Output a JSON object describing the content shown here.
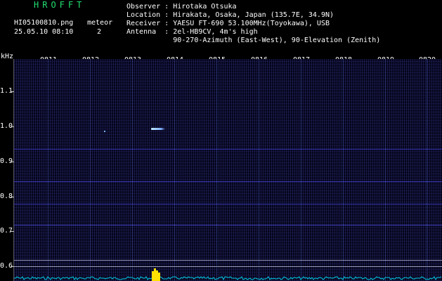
{
  "header": {
    "app_title": "HROFFT",
    "file_name": "HI05100810.png",
    "meteor_label": "meteor",
    "timestamp": "25.05.10 08:10",
    "meteor_count": "2",
    "observer": "Observer : Hirotaka Otsuka",
    "location": "Location : Hirakata, Osaka, Japan (135.7E, 34.9N)",
    "receiver": "Receiver : YAESU FT-690 53.100MHz(Toyokawa), USB",
    "antenna": "Antenna  : 2el-HB9CV, 4m's high",
    "antenna_detail": "           90-270-Azimuth (East-West), 90-Elevation (Zenith)"
  },
  "axis": {
    "unit": "kHz",
    "time_ticks": [
      "0811",
      "0812",
      "0813",
      "0814",
      "0815",
      "0816",
      "0817",
      "0818",
      "0819",
      "0820"
    ],
    "freq_ticks": [
      "1.1",
      "1.0",
      "0.9",
      "0.8",
      "0.7",
      "0.6"
    ]
  },
  "colors": {
    "title": "#22e070",
    "background": "#000000",
    "spectrum_noise": "#1a1a6e",
    "meteor_echo": "#bfe8ff",
    "signal_strength": "#00c8e0",
    "signal_peak": "#ffe000"
  }
}
